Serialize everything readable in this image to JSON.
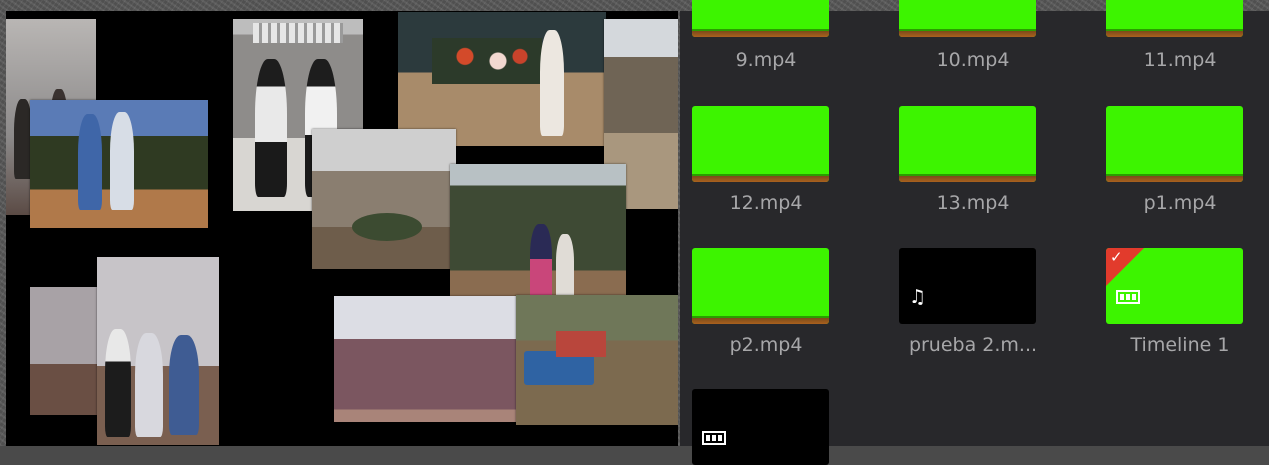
{
  "viewer": {
    "photos": [
      {
        "name": "photo-family-room-top-left"
      },
      {
        "name": "photo-two-women-outdoors"
      },
      {
        "name": "photo-two-girls-bw"
      },
      {
        "name": "photo-woman-with-flowers"
      },
      {
        "name": "photo-village-house"
      },
      {
        "name": "photo-group-garden"
      },
      {
        "name": "photo-woman-trees"
      },
      {
        "name": "photo-family-indoor-left"
      },
      {
        "name": "photo-family-indoor"
      },
      {
        "name": "photo-faded-landscape"
      },
      {
        "name": "photo-truck-farm"
      }
    ]
  },
  "media_pool": {
    "clips": [
      {
        "label": "9.mp4",
        "kind": "green"
      },
      {
        "label": "10.mp4",
        "kind": "green"
      },
      {
        "label": "11.mp4",
        "kind": "green"
      },
      {
        "label": "12.mp4",
        "kind": "green"
      },
      {
        "label": "13.mp4",
        "kind": "green"
      },
      {
        "label": "p1.mp4",
        "kind": "green"
      },
      {
        "label": "p2.mp4",
        "kind": "green"
      },
      {
        "label": "prueba 2.m...",
        "kind": "audio",
        "icon": "music-note-icon"
      },
      {
        "label": "Timeline 1",
        "kind": "timeline",
        "icon": "timeline-icon",
        "marked": true
      },
      {
        "label": "",
        "kind": "timeline-black",
        "icon": "timeline-icon"
      }
    ]
  },
  "colors": {
    "clip_green": "#3df400",
    "bin_background": "#28282b",
    "label_text": "#a7a7a9",
    "flag_red": "#e23b2c"
  }
}
